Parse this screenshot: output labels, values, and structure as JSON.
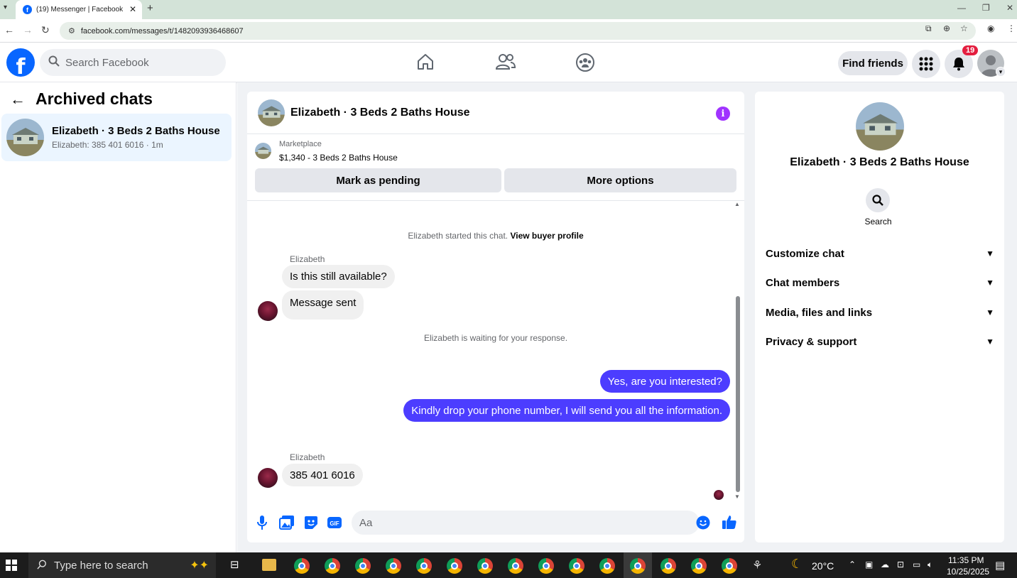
{
  "browser": {
    "tab_title": "(19) Messenger | Facebook",
    "url": "facebook.com/messages/t/1482093936468607"
  },
  "header": {
    "search_placeholder": "Search Facebook",
    "find_friends": "Find friends",
    "notification_count": "19"
  },
  "sidebar": {
    "title": "Archived chats",
    "chats": [
      {
        "name": "Elizabeth · 3 Beds 2 Baths House",
        "preview": "Elizabeth: 385 401 6016 · 1m"
      }
    ]
  },
  "conversation": {
    "title": "Elizabeth · 3 Beds 2 Baths House",
    "marketplace_label": "Marketplace",
    "listing": "$1,340 - 3 Beds 2 Baths House",
    "mark_pending": "Mark as pending",
    "more_options": "More options",
    "started_text": "Elizabeth started this chat.",
    "view_buyer_profile": "View buyer profile",
    "waiting_text": "Elizabeth is waiting for your response.",
    "messages": [
      {
        "sender": "Elizabeth",
        "text": "Is this still available?"
      },
      {
        "sender": "",
        "text": "Message sent"
      },
      {
        "sender": "me",
        "text": "Yes, are you interested?"
      },
      {
        "sender": "me",
        "text": "Kindly drop your phone number, I will send you all the information."
      },
      {
        "sender": "Elizabeth",
        "text": "385 401 6016"
      }
    ],
    "composer_placeholder": "Aa"
  },
  "details": {
    "name": "Elizabeth · 3 Beds 2 Baths House",
    "search_label": "Search",
    "sections": [
      "Customize chat",
      "Chat members",
      "Media, files and links",
      "Privacy & support"
    ]
  },
  "taskbar": {
    "search_placeholder": "Type here to search",
    "temperature": "20°C",
    "time": "11:35 PM",
    "date": "10/25/2025"
  },
  "colors": {
    "facebook_blue": "#0866ff",
    "outgoing_bubble": "#4c3dff",
    "notification_red": "#e41e3f",
    "info_purple": "#a033ff"
  }
}
